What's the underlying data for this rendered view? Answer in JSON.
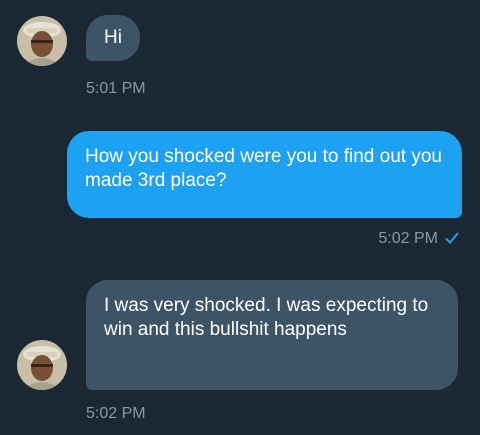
{
  "conversation": {
    "messages": [
      {
        "direction": "incoming",
        "text": "Hi",
        "time": "5:01 PM"
      },
      {
        "direction": "outgoing",
        "text": "How you shocked were you to find out you made 3rd place?",
        "time": "5:02 PM",
        "status": "sent-check"
      },
      {
        "direction": "incoming",
        "text": "I was very shocked. I was expecting to win and this bullshit happens",
        "time": "5:02 PM"
      }
    ],
    "avatar_icon": "user-avatar",
    "colors": {
      "background": "#1b2733",
      "incoming_bubble": "#3d5466",
      "outgoing_bubble": "#1da1f2",
      "timestamp": "#8899a6",
      "checkmark": "#1da1f2"
    }
  }
}
